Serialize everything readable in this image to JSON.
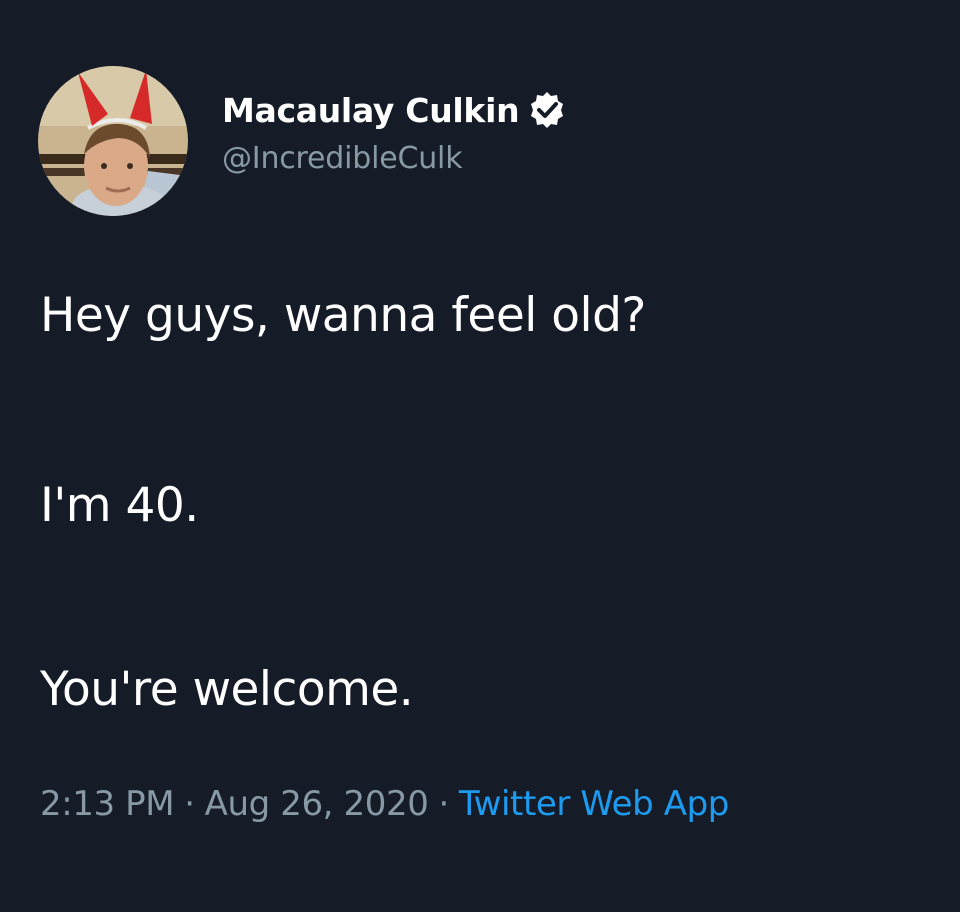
{
  "author": {
    "display_name": "Macaulay Culkin",
    "handle": "@IncredibleCulk",
    "verified": true
  },
  "tweet": {
    "lines": [
      "Hey guys, wanna feel old?",
      "I'm 40.",
      "You're welcome."
    ]
  },
  "meta": {
    "time": "2:13 PM",
    "separator": "·",
    "date": "Aug 26, 2020",
    "source": "Twitter Web App"
  },
  "icons": {
    "avatar": "profile-photo",
    "verified": "verified-badge-icon"
  },
  "colors": {
    "background": "#161c27",
    "primary_text": "#ffffff",
    "secondary_text": "#8899a6",
    "link": "#1d9bf0"
  }
}
